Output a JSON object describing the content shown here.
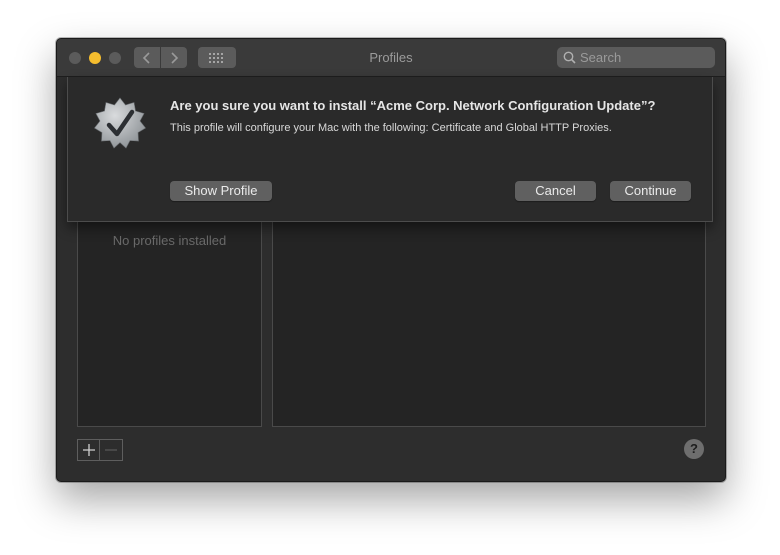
{
  "window": {
    "title": "Profiles"
  },
  "toolbar": {
    "search_placeholder": "Search",
    "back_icon": "chevron-left-icon",
    "forward_icon": "chevron-right-icon",
    "grid_icon": "grid-icon"
  },
  "sidebar": {
    "empty_text": "No profiles installed"
  },
  "footer": {
    "add_label": "+",
    "remove_label": "—",
    "help_label": "?"
  },
  "dialog": {
    "title": "Are you sure you want to install “Acme Corp. Network Configuration Update”?",
    "message": "This profile will configure your Mac with the following: Certificate and Global HTTP Proxies.",
    "show_profile_label": "Show Profile",
    "cancel_label": "Cancel",
    "continue_label": "Continue",
    "icon": "verified-badge-checkmark-icon"
  },
  "colors": {
    "window_bg": "#2d2d2d",
    "titlebar_bg": "#3a3a3a",
    "minimize_yellow": "#f5bd2e",
    "button_bg": "#606060"
  }
}
